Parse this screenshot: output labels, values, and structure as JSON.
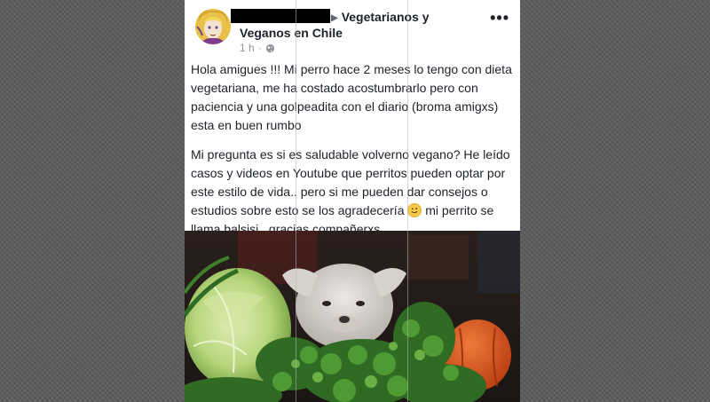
{
  "post": {
    "group_name_line1": "Vegetarianos y",
    "group_name_line2": "Veganos en Chile",
    "time": "1 h",
    "more_label": "•••",
    "paragraph1": "Hola amigues !!! Mi perro hace 2 meses lo tengo con dieta vegetariana, me ha costado acostumbrarlo pero con paciencia y una golpeadita con el diario (broma amigxs) esta en buen rumbo",
    "paragraph2_before_emoji": "Mi pregunta es si es saludable volverno vegano? He leído casos y videos en Youtube que perritos pueden optar por este estilo de vida.. pero si me pueden dar consejos o estudios sobre esto se los agradecería ",
    "paragraph2_after_emoji": " mi perrito se llama balsisi , gracias compañerxs"
  },
  "icons": {
    "audience": "globe-icon",
    "emoji": "smile-emoji-icon",
    "more": "more-dots-icon"
  },
  "colors": {
    "background": "#5e5e5e",
    "card": "#ffffff",
    "text": "#1d2129",
    "meta": "#90949c"
  }
}
